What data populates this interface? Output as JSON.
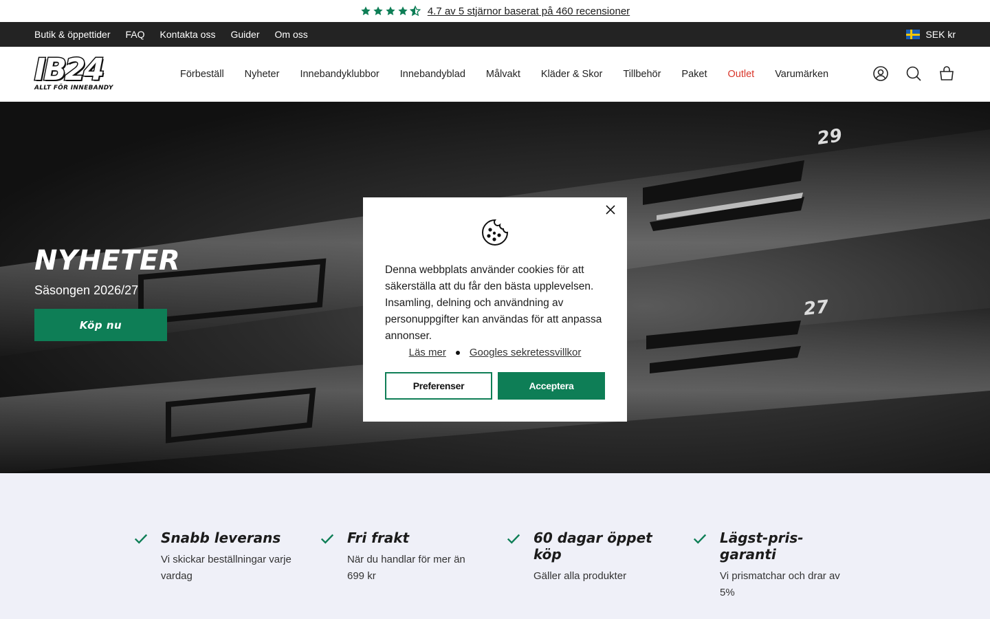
{
  "reviews": {
    "text": "4.7 av 5 stjärnor baserat på 460 recensioner",
    "stars": 4.5,
    "color": "#0e7e56"
  },
  "utility": {
    "links": [
      "Butik & öppettider",
      "FAQ",
      "Kontakta oss",
      "Guider",
      "Om oss"
    ],
    "currency": "SEK kr"
  },
  "header": {
    "logo_main": "IB24",
    "logo_sub": "ALLT FÖR INNEBANDY",
    "nav": [
      "Förbeställ",
      "Nyheter",
      "Innebandyklubbor",
      "Innebandyblad",
      "Målvakt",
      "Kläder & Skor",
      "Tillbehör",
      "Paket",
      "Outlet",
      "Varumärken"
    ],
    "icons": [
      "account-icon",
      "search-icon",
      "cart-icon"
    ]
  },
  "hero": {
    "title": "NYHETER",
    "subtitle": "Säsongen 2026/27",
    "button": "Köp nu",
    "stick_numbers": [
      "29",
      "27"
    ]
  },
  "usps": [
    {
      "title": "Snabb leverans",
      "desc": "Vi skickar beställningar varje vardag"
    },
    {
      "title": "Fri frakt",
      "desc": "När du handlar för mer än 699 kr"
    },
    {
      "title": "60 dagar öppet köp",
      "desc": "Gäller alla produkter"
    },
    {
      "title": "Lägst-pris-garanti",
      "desc": "Vi prismatchar och drar av 5%"
    }
  ],
  "cookie": {
    "text": "Denna webbplats använder cookies för att säkerställa att du får den bästa upplevelsen. Insamling, delning och användning av personuppgifter kan användas för att anpassa annonser.",
    "link_more": "Läs mer",
    "link_google": "Googles sekretessvillkor",
    "btn_preferences": "Preferenser",
    "btn_accept": "Acceptera"
  },
  "colors": {
    "brand_green": "#0e7e56",
    "outlet_red": "#d9352a",
    "topbar": "#232323",
    "usp_bg": "#eff0f8"
  }
}
